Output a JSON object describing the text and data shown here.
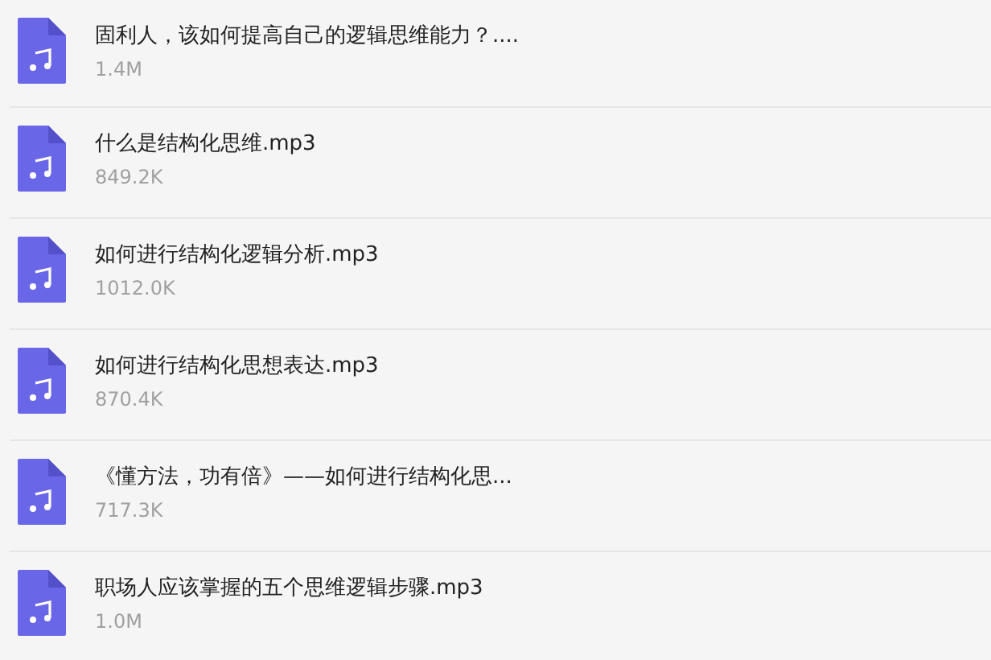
{
  "files": [
    {
      "name": "固利人，该如何提高自己的逻辑思维能力？....",
      "size": "1.4M"
    },
    {
      "name": "什么是结构化思维.mp3",
      "size": "849.2K"
    },
    {
      "name": "如何进行结构化逻辑分析.mp3",
      "size": "1012.0K"
    },
    {
      "name": "如何进行结构化思想表达.mp3",
      "size": "870.4K"
    },
    {
      "name": "《懂方法，功有倍》——如何进行结构化思...",
      "size": "717.3K"
    },
    {
      "name": "职场人应该掌握的五个思维逻辑步骤.mp3",
      "size": "1.0M"
    }
  ]
}
